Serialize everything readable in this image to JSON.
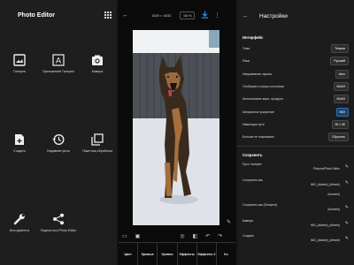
{
  "editor_home": {
    "title": "Photo Editor",
    "tiles": [
      {
        "label": "Галерея",
        "icon": "gallery-icon"
      },
      {
        "label": "Приложение Галерея",
        "icon": "gallery-app-icon"
      },
      {
        "label": "Камера",
        "icon": "camera-icon"
      },
      {
        "label": "Создать",
        "icon": "create-icon"
      },
      {
        "label": "Недавние фото",
        "icon": "history-icon"
      },
      {
        "label": "Пакетная обработка",
        "icon": "batch-icon"
      },
      {
        "label": "Инструменты",
        "icon": "tools-icon"
      },
      {
        "label": "Поделиться Photo Editor",
        "icon": "share-icon"
      }
    ]
  },
  "editor_view": {
    "resolution": "1520 × 4032",
    "zoom": "58 %",
    "tabs": [
      "Цвет",
      "Кривые",
      "Уровни",
      "Эффекты",
      "Эффекты 2",
      "Ко"
    ],
    "accent": "#2e8bd9"
  },
  "settings": {
    "title": "Настройки",
    "interface_section": "Интерфейс",
    "interface_rows": [
      {
        "label": "Тема",
        "value": "Темная",
        "active": false
      },
      {
        "label": "Язык",
        "value": "Русский",
        "active": false
      },
      {
        "label": "Направление экрана",
        "value": "Авто",
        "active": false
      },
      {
        "label": "Отобразить строку состояния",
        "value": "ВЫКЛ",
        "active": false
      },
      {
        "label": "Использовать масс. прокрутк",
        "value": "ВЫКЛ",
        "active": false
      },
      {
        "label": "Аппаратное ускорение",
        "value": "ВКЛ",
        "active": true
      },
      {
        "label": "Навигация пути",
        "value": "80 × 80",
        "active": false
      },
      {
        "label": "Больше не показывать",
        "value": "Сбросить",
        "active": false
      }
    ],
    "save_section": "Сохранить",
    "save_rows": [
      {
        "label": "Путь Галереи",
        "value": "Pictures/Photo Editor"
      },
      {
        "label": "Сохранить как",
        "value": "IMG_(#date#)_(#time#)"
      },
      {
        "label": "",
        "value": "(#name#)"
      },
      {
        "label": "Сохранить как (Галерея)",
        "value": "(#name#)"
      },
      {
        "label": "Камера",
        "value": "IMG_(#date#)_(#time#)"
      },
      {
        "label": "Создать",
        "value": "IMG_(#date#)_(#time#)"
      }
    ]
  }
}
